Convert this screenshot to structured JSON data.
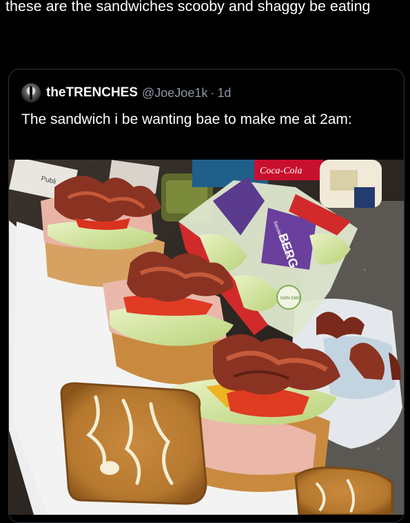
{
  "post": {
    "text": "these are the sandwiches scooby and shaggy be eating"
  },
  "quoted_post": {
    "display_name": "theTRENCHES",
    "handle": "@JoeJoe1k",
    "separator": "·",
    "time": "1d",
    "text": "The sandwich i be wanting bae to make me at 2am:",
    "image": {
      "icon": "sandwich-photo",
      "labels": [
        "Publi",
        "Coca-Cola",
        "BERG",
        "NON GMO",
        "Sandwich & Salad"
      ]
    }
  },
  "colors": {
    "background": "#000000",
    "text": "#ffffff",
    "secondary_text": "#8b98a5",
    "card_border": "#2f3336"
  }
}
